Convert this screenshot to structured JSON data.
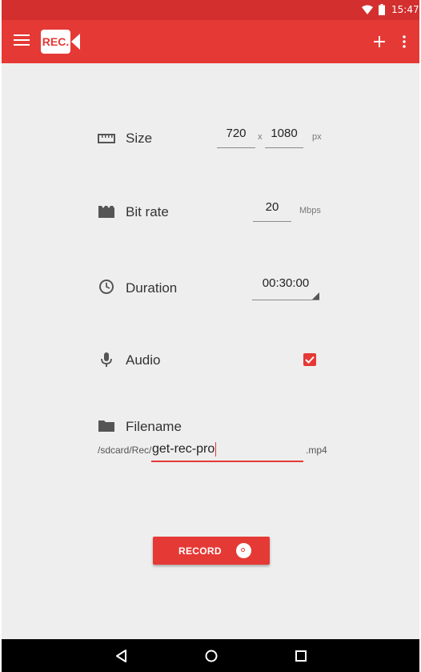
{
  "status_bar": {
    "time": "15:47",
    "icons": [
      "wifi-icon",
      "battery-icon"
    ]
  },
  "app_bar": {
    "logo_text": "REC.",
    "icons": [
      "menu-icon",
      "add-icon",
      "more-vert-icon"
    ],
    "accent_color": "#e53935",
    "status_color": "#d32f2f"
  },
  "settings": {
    "size": {
      "label": "Size",
      "width": "720",
      "separator": "x",
      "height": "1080",
      "unit": "px",
      "icon": "ruler-icon"
    },
    "bitrate": {
      "label": "Bit rate",
      "value": "20",
      "unit": "Mbps",
      "icon": "clapperboard-icon"
    },
    "duration": {
      "label": "Duration",
      "value": "00:30:00",
      "icon": "clock-icon"
    },
    "audio": {
      "label": "Audio",
      "checked": true,
      "icon": "microphone-icon"
    },
    "filename": {
      "label": "Filename",
      "prefix": "/sdcard/Rec/",
      "value": "get-rec-pro",
      "extension": ".mp4",
      "icon": "folder-icon"
    }
  },
  "record_button": {
    "label": "RECORD"
  },
  "nav_bar": {
    "icons": [
      "back-icon",
      "home-icon",
      "recents-icon"
    ]
  }
}
